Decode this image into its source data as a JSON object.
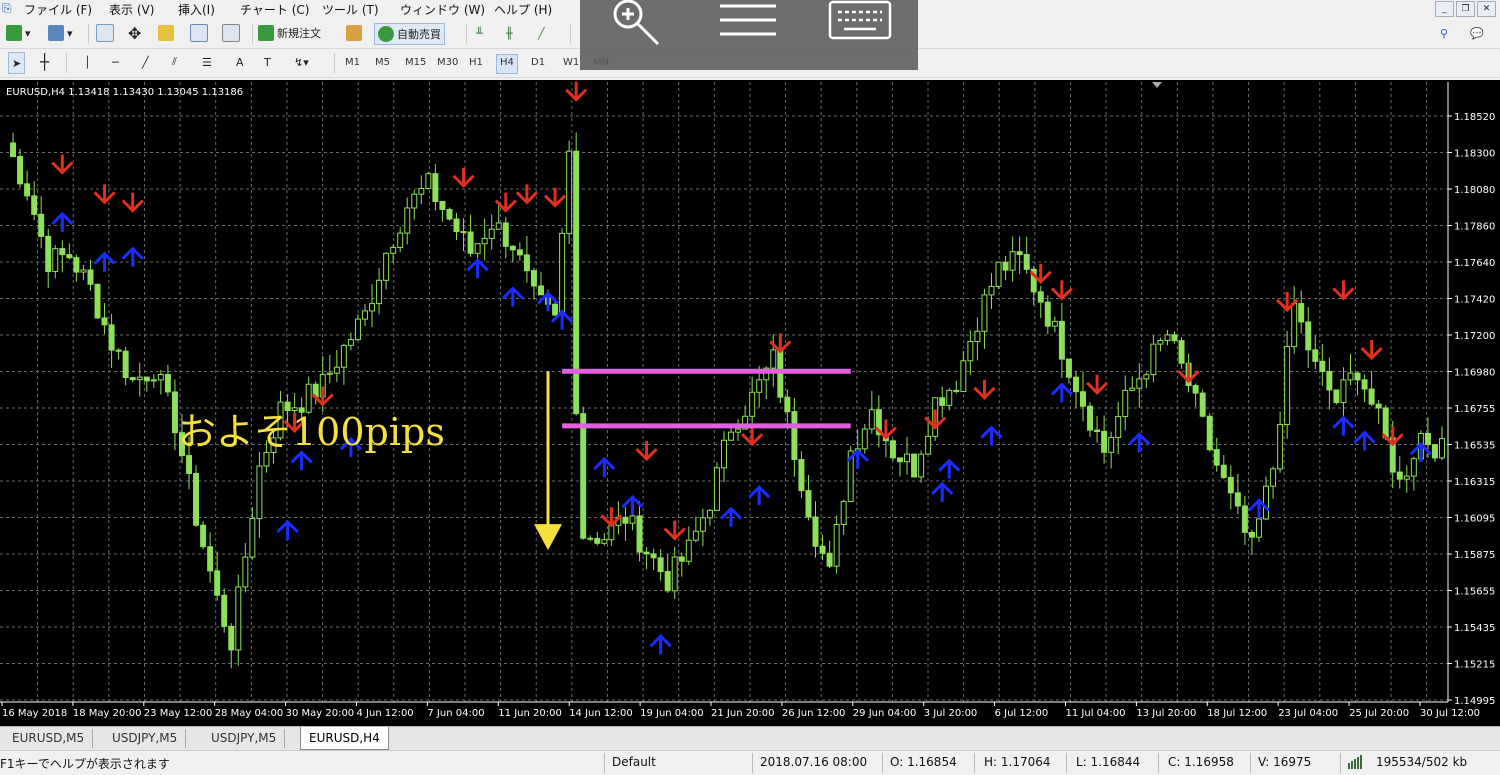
{
  "menu": [
    "ファイル (F)",
    "表示 (V)",
    "挿入(I)",
    "チャート (C)",
    "ツール (T)",
    "ウィンドウ (W)",
    "ヘルプ (H)"
  ],
  "toolbar": {
    "new_order": "新規注文",
    "auto_trade": "自動売買"
  },
  "timeframes": [
    "M1",
    "M5",
    "M15",
    "M30",
    "H1",
    "H4",
    "D1",
    "W1",
    "MN"
  ],
  "active_timeframe": "H4",
  "chart_info": "EURUSD,H4  1.13418 1.13430 1.13045 1.13186",
  "annotation": {
    "text": "およそ100pips"
  },
  "price_axis": [
    "1.18520",
    "1.18300",
    "1.18080",
    "1.17860",
    "1.17640",
    "1.17420",
    "1.17200",
    "1.16980",
    "1.16755",
    "1.16535",
    "1.16315",
    "1.16095",
    "1.15875",
    "1.15655",
    "1.15435",
    "1.15215",
    "1.14995"
  ],
  "time_axis": [
    "16 May 2018",
    "18 May 20:00",
    "23 May 12:00",
    "28 May 04:00",
    "30 May 20:00",
    "4 Jun 12:00",
    "7 Jun 04:00",
    "11 Jun 20:00",
    "14 Jun 12:00",
    "19 Jun 04:00",
    "21 Jun 20:00",
    "26 Jun 12:00",
    "29 Jun 04:00",
    "3 Jul 20:00",
    "6 Jul 12:00",
    "11 Jul 04:00",
    "13 Jul 20:00",
    "18 Jul 12:00",
    "23 Jul 04:00",
    "25 Jul 20:00",
    "30 Jul 12:00"
  ],
  "tabs": [
    "EURUSD,M5",
    "USDJPY,M5",
    "USDJPY,M5",
    "EURUSD,H4"
  ],
  "active_tab": 3,
  "status": {
    "help": "F1キーでヘルプが表示されます",
    "profile": "Default",
    "datetime": "2018.07.16 08:00",
    "open": "O: 1.16854",
    "high": "H: 1.17064",
    "low": "L: 1.16844",
    "close": "C: 1.16958",
    "volume": "V: 16975",
    "traffic": "195534/502 kb"
  },
  "colors": {
    "candle": "#8ee05a",
    "sell_arrow": "#e03020",
    "buy_arrow": "#1a2cff",
    "range_line": "#e060e0",
    "annotation": "#f5e040",
    "grid": "#6a6a6a"
  },
  "chart_data": {
    "type": "candlestick",
    "symbol": "EURUSD",
    "timeframe": "H4",
    "ylim": [
      1.14995,
      1.1863
    ],
    "close_path": [
      [
        0,
        1.1836
      ],
      [
        3,
        1.1808
      ],
      [
        6,
        1.1765
      ],
      [
        9,
        1.1768
      ],
      [
        12,
        1.1748
      ],
      [
        15,
        1.1715
      ],
      [
        18,
        1.1692
      ],
      [
        21,
        1.17
      ],
      [
        24,
        1.1667
      ],
      [
        27,
        1.161
      ],
      [
        30,
        1.156
      ],
      [
        32,
        1.1535
      ],
      [
        33,
        1.156
      ],
      [
        36,
        1.164
      ],
      [
        39,
        1.1675
      ],
      [
        42,
        1.168
      ],
      [
        45,
        1.169
      ],
      [
        48,
        1.1712
      ],
      [
        51,
        1.1732
      ],
      [
        54,
        1.177
      ],
      [
        57,
        1.1798
      ],
      [
        60,
        1.181
      ],
      [
        63,
        1.179
      ],
      [
        66,
        1.177
      ],
      [
        69,
        1.1788
      ],
      [
        72,
        1.1775
      ],
      [
        75,
        1.1742
      ],
      [
        78,
        1.1728
      ],
      [
        80,
        1.183
      ],
      [
        81,
        1.168
      ],
      [
        82,
        1.16
      ],
      [
        85,
        1.1598
      ],
      [
        88,
        1.161
      ],
      [
        91,
        1.159
      ],
      [
        94,
        1.1572
      ],
      [
        97,
        1.159
      ],
      [
        100,
        1.162
      ],
      [
        103,
        1.1665
      ],
      [
        106,
        1.1682
      ],
      [
        109,
        1.1705
      ],
      [
        112,
        1.165
      ],
      [
        115,
        1.16
      ],
      [
        117,
        1.1575
      ],
      [
        120,
        1.165
      ],
      [
        123,
        1.1675
      ],
      [
        126,
        1.165
      ],
      [
        129,
        1.164
      ],
      [
        132,
        1.168
      ],
      [
        135,
        1.1692
      ],
      [
        138,
        1.173
      ],
      [
        141,
        1.176
      ],
      [
        144,
        1.1765
      ],
      [
        147,
        1.1742
      ],
      [
        150,
        1.1712
      ],
      [
        153,
        1.168
      ],
      [
        156,
        1.165
      ],
      [
        159,
        1.168
      ],
      [
        162,
        1.1702
      ],
      [
        165,
        1.172
      ],
      [
        168,
        1.169
      ],
      [
        171,
        1.1652
      ],
      [
        174,
        1.162
      ],
      [
        177,
        1.159
      ],
      [
        180,
        1.164
      ],
      [
        183,
        1.1738
      ],
      [
        186,
        1.17
      ],
      [
        189,
        1.168
      ],
      [
        192,
        1.17
      ],
      [
        195,
        1.1668
      ],
      [
        198,
        1.163
      ],
      [
        201,
        1.166
      ],
      [
        204,
        1.165
      ]
    ],
    "sell_signals": [
      [
        8,
        1.1818
      ],
      [
        14,
        1.18
      ],
      [
        18,
        1.1795
      ],
      [
        45,
        1.1678
      ],
      [
        41,
        1.1662
      ],
      [
        65,
        1.181
      ],
      [
        71,
        1.1795
      ],
      [
        74,
        1.18
      ],
      [
        78,
        1.1798
      ],
      [
        81,
        1.1862
      ],
      [
        86,
        1.1605
      ],
      [
        91,
        1.1645
      ],
      [
        95,
        1.1597
      ],
      [
        106,
        1.1654
      ],
      [
        110,
        1.171
      ],
      [
        125,
        1.1658
      ],
      [
        132,
        1.1664
      ],
      [
        139,
        1.1682
      ],
      [
        147,
        1.1752
      ],
      [
        150,
        1.1742
      ],
      [
        155,
        1.1685
      ],
      [
        168,
        1.1692
      ],
      [
        182,
        1.1735
      ],
      [
        190,
        1.1742
      ],
      [
        194,
        1.1706
      ],
      [
        197,
        1.1654
      ]
    ],
    "buy_signals": [
      [
        8,
        1.1793
      ],
      [
        14,
        1.1769
      ],
      [
        18,
        1.1772
      ],
      [
        40,
        1.1607
      ],
      [
        42,
        1.1649
      ],
      [
        49,
        1.1657
      ],
      [
        67,
        1.1765
      ],
      [
        72,
        1.1748
      ],
      [
        77,
        1.1745
      ],
      [
        79,
        1.1734
      ],
      [
        85,
        1.1645
      ],
      [
        89,
        1.1622
      ],
      [
        93,
        1.1538
      ],
      [
        103,
        1.1615
      ],
      [
        107,
        1.1628
      ],
      [
        121,
        1.165
      ],
      [
        134,
        1.1644
      ],
      [
        133,
        1.163
      ],
      [
        140,
        1.1664
      ],
      [
        150,
        1.169
      ],
      [
        161,
        1.166
      ],
      [
        178,
        1.162
      ],
      [
        190,
        1.167
      ],
      [
        193,
        1.1661
      ],
      [
        201,
        1.1654
      ]
    ],
    "range_lines": [
      1.1698,
      1.1665
    ],
    "annotation_arrow": {
      "from": 1.1698,
      "to": 1.159
    },
    "grid": true
  }
}
